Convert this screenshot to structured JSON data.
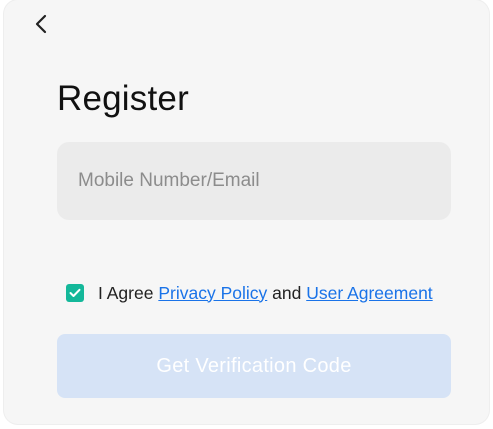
{
  "header": {
    "back_icon": "chevron-left-icon",
    "title": "Register"
  },
  "form": {
    "contact_placeholder": "Mobile Number/Email",
    "contact_value": ""
  },
  "agreement": {
    "checked": true,
    "check_icon": "checkmark-icon",
    "check_color": "#14b89a",
    "prefix": "I Agree",
    "privacy_link": "Privacy Policy",
    "conjunction": "and",
    "user_agreement_link": "User Agreement",
    "link_color": "#1a73e8"
  },
  "submit": {
    "label": "Get Verification Code",
    "enabled": false,
    "background_color": "#d6e3f6"
  }
}
